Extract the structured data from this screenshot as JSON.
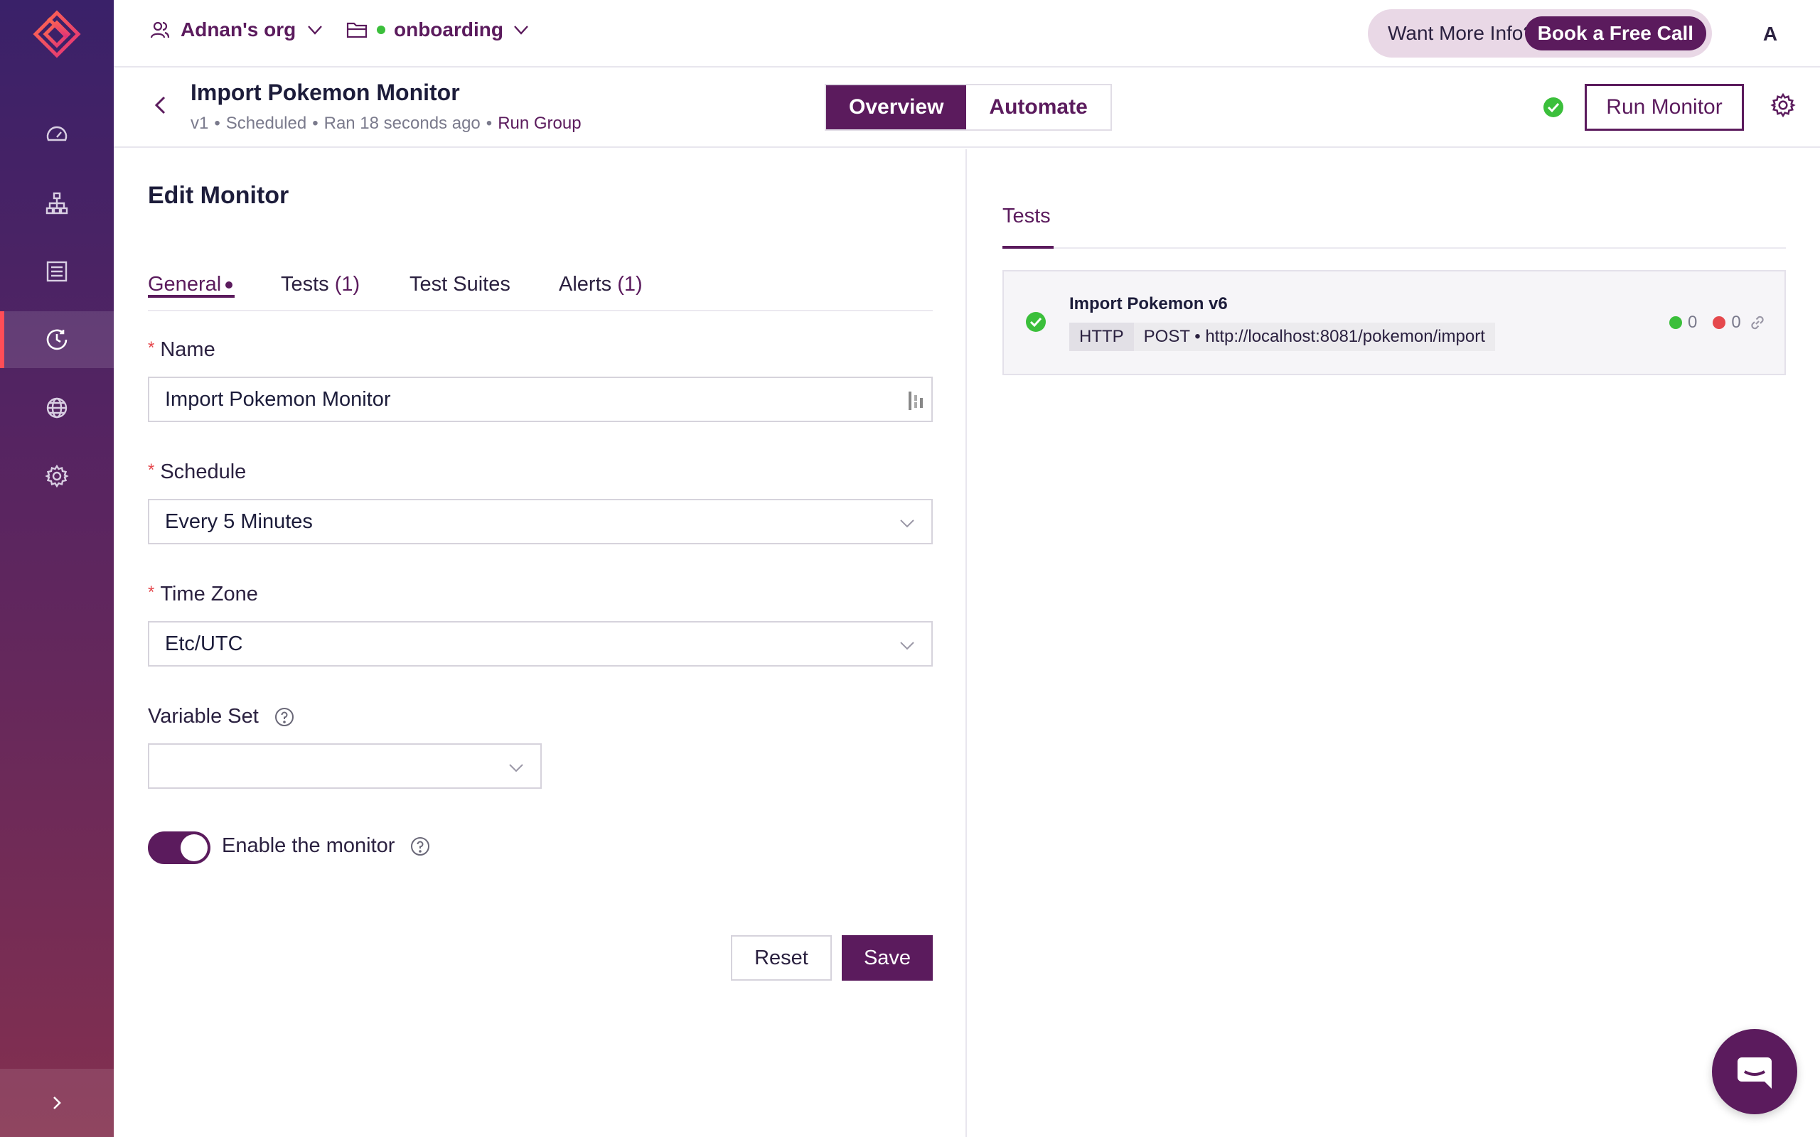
{
  "colors": {
    "brand": "#5b1b5d",
    "success": "#3bbf3b",
    "error": "#e5484d",
    "active_nav_marker": "#ff4d57"
  },
  "sidebar": {
    "items": [
      {
        "icon": "dashboard-icon"
      },
      {
        "icon": "hierarchy-icon"
      },
      {
        "icon": "collection-icon"
      },
      {
        "icon": "clock-icon",
        "active": true
      },
      {
        "icon": "globe-icon"
      },
      {
        "icon": "gear-icon"
      }
    ],
    "expand_icon": "chevron-right-icon"
  },
  "topbar": {
    "org_name": "Adnan's org",
    "project_name": "onboarding",
    "promo_text": "Want More Info?",
    "promo_button": "Book a Free Call",
    "avatar_initial": "A"
  },
  "monitor": {
    "title": "Import Pokemon Monitor",
    "version": "v1",
    "status": "Scheduled",
    "last_run": "Ran 18 seconds ago",
    "run_group_link": "Run Group",
    "tabs": [
      "Overview",
      "Automate"
    ],
    "active_tab": "Overview",
    "run_button": "Run Monitor"
  },
  "edit": {
    "title": "Edit Monitor",
    "tabs": [
      {
        "label": "General",
        "count": ""
      },
      {
        "label": "Tests",
        "count": "(1)"
      },
      {
        "label": "Test Suites",
        "count": ""
      },
      {
        "label": "Alerts",
        "count": "(1)"
      }
    ],
    "name_label": "Name",
    "name_value": "Import Pokemon Monitor",
    "schedule_label": "Schedule",
    "schedule_value": "Every 5 Minutes",
    "timezone_label": "Time Zone",
    "timezone_value": "Etc/UTC",
    "variable_set_label": "Variable Set",
    "variable_set_value": "",
    "enable_label": "Enable the monitor",
    "enabled": true,
    "reset_button": "Reset",
    "save_button": "Save"
  },
  "tests_panel": {
    "tab": "Tests",
    "tests": [
      {
        "name": "Import Pokemon v6",
        "protocol": "HTTP",
        "method_url": "POST • http://localhost:8081/pokemon/import",
        "passed": "0",
        "failed": "0"
      }
    ]
  }
}
